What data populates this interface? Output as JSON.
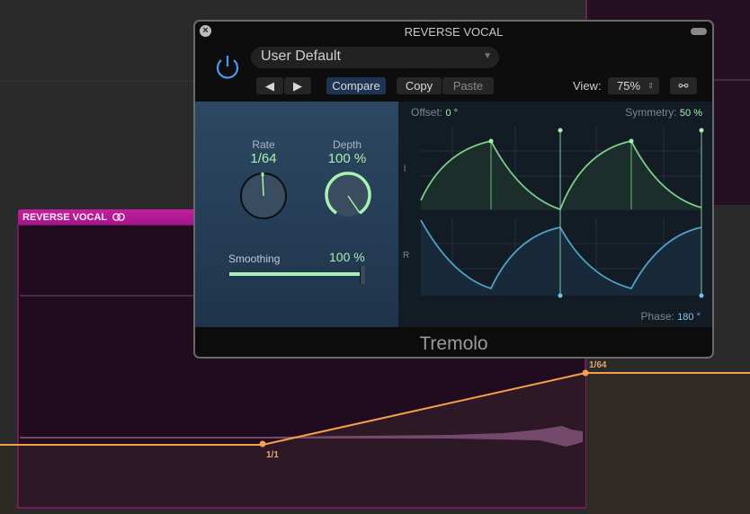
{
  "track_region": {
    "name": "REVERSE VOCAL",
    "loop_icon": "loop-rings-icon",
    "color": "#b81c96"
  },
  "automation": {
    "start_label": "1/1",
    "end_label": "1/64",
    "color": "#f5a04a"
  },
  "plugin": {
    "title": "REVERSE VOCAL",
    "preset": "User Default",
    "compare_label": "Compare",
    "copy_label": "Copy",
    "paste_label": "Paste",
    "view_label": "View:",
    "view_value": "75%",
    "name": "Tremolo",
    "rate": {
      "label": "Rate",
      "value": "1/64"
    },
    "depth": {
      "label": "Depth",
      "value": "100 %",
      "level": 1.0
    },
    "smoothing": {
      "label": "Smoothing",
      "value": "100 %",
      "level": 1.0
    },
    "offset": {
      "label": "Offset:",
      "value": "0 °"
    },
    "symmetry": {
      "label": "Symmetry:",
      "value": "50 %"
    },
    "phase": {
      "label": "Phase:",
      "value": "180 °"
    },
    "channel_left": "l",
    "channel_right": "R",
    "colors": {
      "left_wave": "#7fcf8c",
      "right_wave": "#4fa3c7",
      "accent": "#a7f2b0",
      "power": "#4a9bf0"
    }
  }
}
